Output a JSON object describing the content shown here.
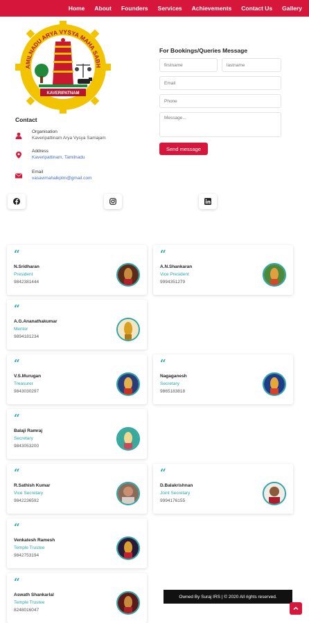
{
  "nav": {
    "items": [
      "Home",
      "About",
      "Founders",
      "Services",
      "Achievements",
      "Contact Us",
      "Gallery"
    ]
  },
  "logo": {
    "arc_text": "TAMILNADU ARYA VYSYA MAHA SABHA",
    "banner_text": "KAVERIPATNAM"
  },
  "contact": {
    "title": "Contact",
    "organisation_label": "Organisation",
    "organisation_value": "Kaveripattinam Arya Vysya Samajam",
    "address_label": "Address",
    "address_value": "Kaveripattinam, Tamilnadu",
    "email_label": "Email",
    "email_value": "vasavimahalkptm@gmail.com"
  },
  "form": {
    "title": "For Bookings/Queries Message",
    "firstname_placeholder": "firstname",
    "lastname_placeholder": "lastname",
    "email_placeholder": "Email",
    "phone_placeholder": "Phone",
    "message_placeholder": "Message...",
    "send_label": "Send message"
  },
  "social": {
    "icons": [
      "facebook-icon",
      "instagram-icon",
      "linkedin-icon"
    ]
  },
  "members": [
    {
      "name": "N.Sridharan",
      "role": "President",
      "phone": "9842381444"
    },
    {
      "name": "A.N.Shankaran",
      "role": "Vice President",
      "phone": "9994351279"
    },
    {
      "name": "A.G.Ananathakumar",
      "role": "Mentor",
      "phone": "9894181234"
    },
    {
      "name": "V.S.Murugan",
      "role": "Treasurer",
      "phone": "9843030297"
    },
    {
      "name": "Nagaganesh",
      "role": "Secretary",
      "phone": "9865183818"
    },
    {
      "name": "Balaji Ramraj",
      "role": "Secretary",
      "phone": "9843053200"
    },
    {
      "name": "R.Sathish Kumar",
      "role": "Vice Secretary",
      "phone": "9842236592"
    },
    {
      "name": "D.Balakrishnan",
      "role": "Joint Secretary",
      "phone": "9994176155"
    },
    {
      "name": "Venkatesh Ramesh",
      "role": "Temple Trustee",
      "phone": "9842753194"
    },
    {
      "name": "Aswath Shankarlal",
      "role": "Temple Trustee",
      "phone": "8248016047"
    }
  ],
  "footer": {
    "text": "Owned By Suraj IRS | © 2020 All rights reserved."
  },
  "colors": {
    "brand_red": "#d6173b",
    "accent_teal": "#2aa5a8",
    "footer_black": "#111111"
  }
}
